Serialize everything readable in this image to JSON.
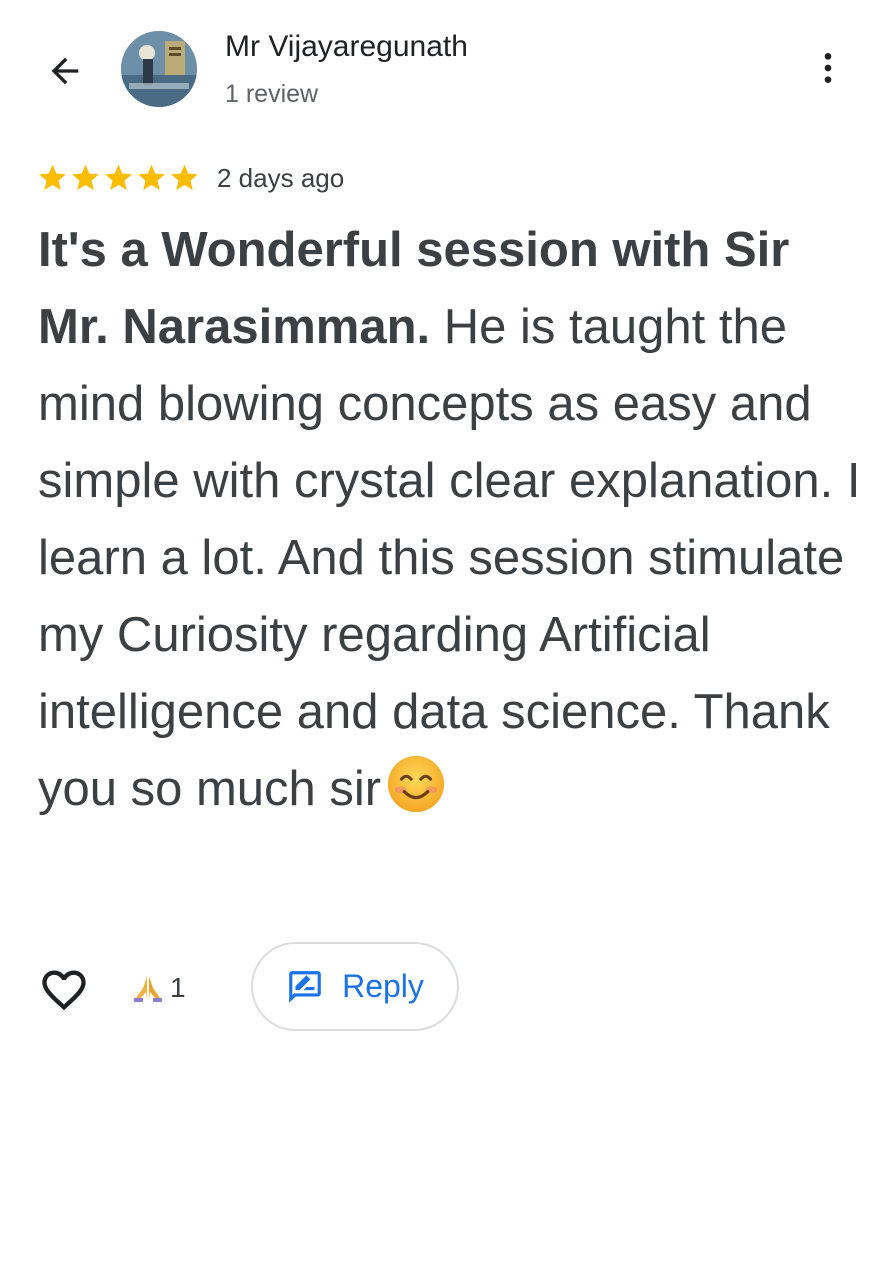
{
  "header": {
    "back_icon": "arrow-back-icon",
    "reviewer_name": "Mr Vijayaregunath",
    "review_count": "1 review",
    "more_icon": "more-vert-icon"
  },
  "review": {
    "rating": 5,
    "rating_max": 5,
    "star_color": "#fbbc04",
    "date": "2 days ago",
    "text_bold": "It's a Wonderful session with Sir Mr. Narasimman.",
    "text_body": " He is taught the mind blowing concepts as easy and simple with crystal clear explanation. I learn a lot. And this session stimulate my Curiosity regarding Artificial intelligence and data science. Thank you so much sir",
    "emoji": "smiling-face-icon"
  },
  "actions": {
    "like_icon": "heart-outline-icon",
    "reaction_icon": "folded-hands-icon",
    "reaction_count": "1",
    "reply_icon": "rate-review-icon",
    "reply_label": "Reply",
    "accent_color": "#1a73e8"
  }
}
